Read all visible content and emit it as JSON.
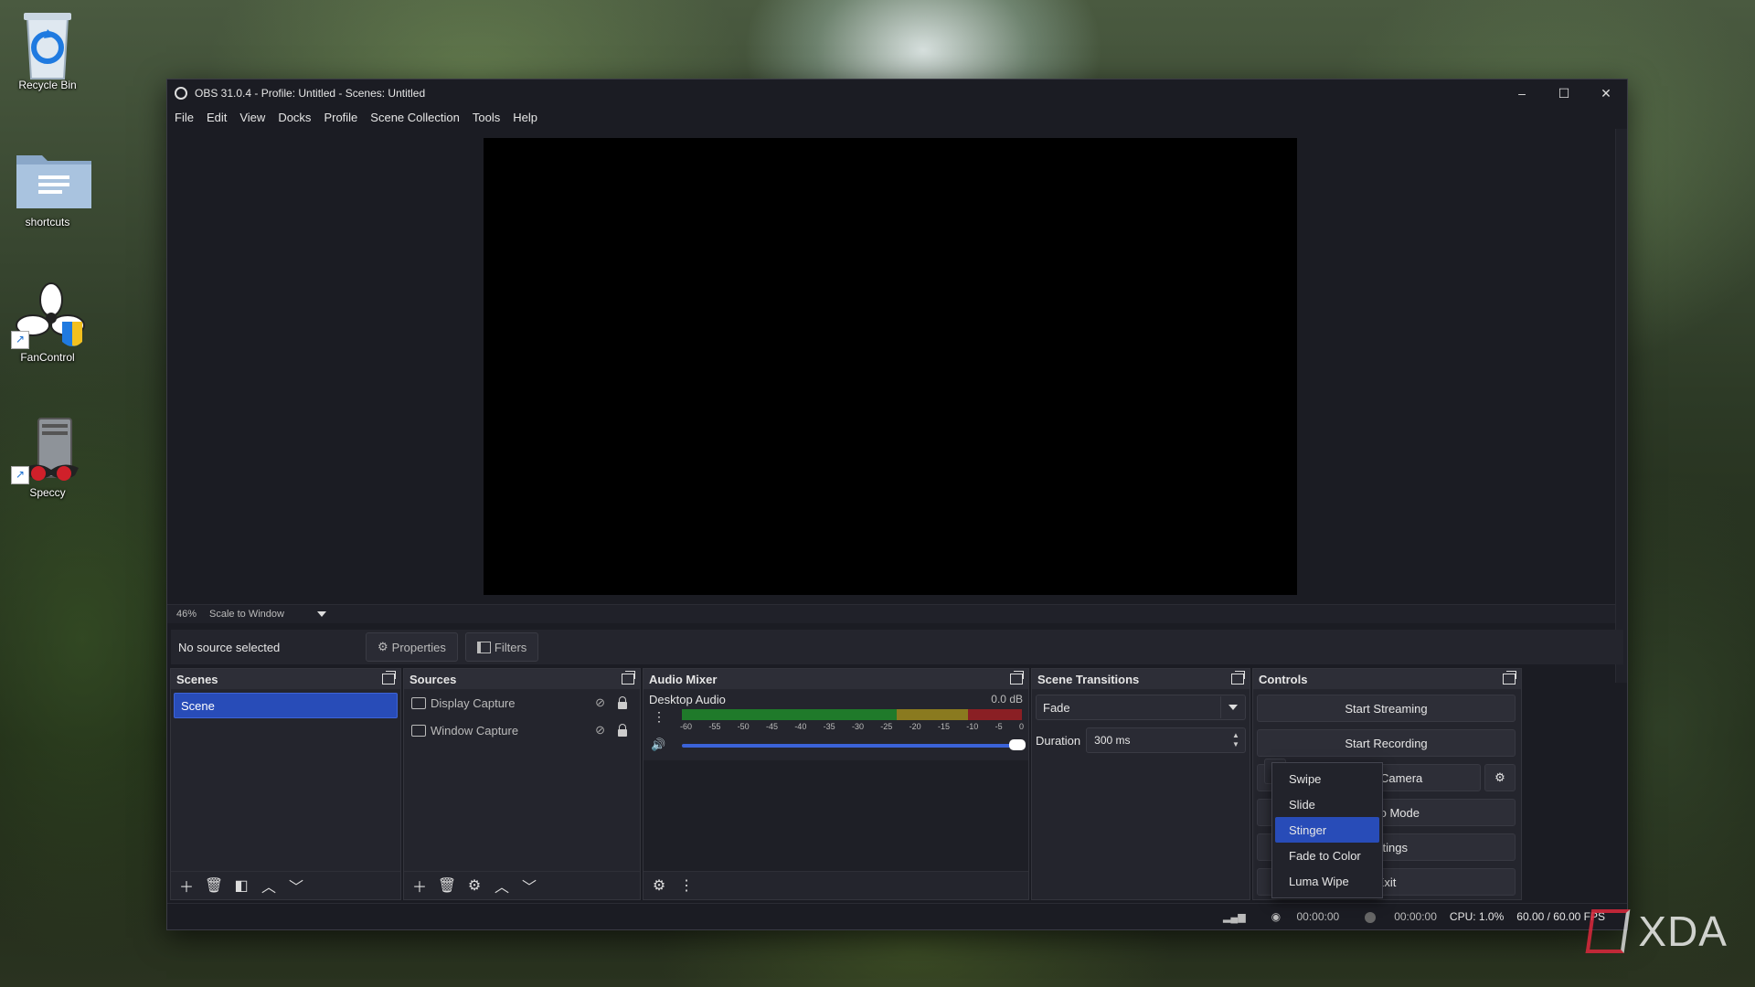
{
  "desktop": {
    "icons": [
      {
        "label": "Recycle Bin"
      },
      {
        "label": "shortcuts"
      },
      {
        "label": "FanControl"
      },
      {
        "label": "Speccy"
      }
    ]
  },
  "window": {
    "title": "OBS 31.0.4 - Profile: Untitled - Scenes: Untitled",
    "controls": {
      "minimize": "–",
      "maximize": "☐",
      "close": "✕"
    }
  },
  "menu": [
    "File",
    "Edit",
    "View",
    "Docks",
    "Profile",
    "Scene Collection",
    "Tools",
    "Help"
  ],
  "preview": {
    "zoom": "46%",
    "scale_mode": "Scale to Window"
  },
  "source_bar": {
    "status": "No source selected",
    "properties_label": "Properties",
    "filters_label": "Filters"
  },
  "docks": {
    "scenes": {
      "title": "Scenes",
      "items": [
        "Scene"
      ]
    },
    "sources": {
      "title": "Sources",
      "items": [
        "Display Capture",
        "Window Capture"
      ]
    },
    "audio_mixer": {
      "title": "Audio Mixer",
      "channel": "Desktop Audio",
      "level": "0.0 dB",
      "ticks": [
        "-60",
        "-55",
        "-50",
        "-45",
        "-40",
        "-35",
        "-30",
        "-25",
        "-20",
        "-15",
        "-10",
        "-5",
        "0"
      ],
      "volume": 1.0
    },
    "scene_transitions": {
      "title": "Scene Transitions",
      "selected": "Fade",
      "duration_label": "Duration",
      "duration_value": "300 ms",
      "dropdown_options": [
        "Swipe",
        "Slide",
        "Stinger",
        "Fade to Color",
        "Luma Wipe"
      ],
      "highlighted_option": "Stinger"
    },
    "controls": {
      "title": "Controls",
      "buttons": [
        "Start Streaming",
        "Start Recording",
        "Start Virtual Camera",
        "Studio Mode",
        "Settings",
        "Exit"
      ]
    }
  },
  "status": {
    "stream_time": "00:00:00",
    "record_time": "00:00:00",
    "cpu": "CPU: 1.0%",
    "fps": "60.00 / 60.00 FPS"
  },
  "watermark": "XDA",
  "colors": {
    "accent": "#284cb8",
    "window_bg": "#1b1c23",
    "dock_bg": "#24252d",
    "meter_green": "#1f7a2a",
    "meter_yellow": "#8a7a1f",
    "meter_red": "#8a1f24"
  }
}
